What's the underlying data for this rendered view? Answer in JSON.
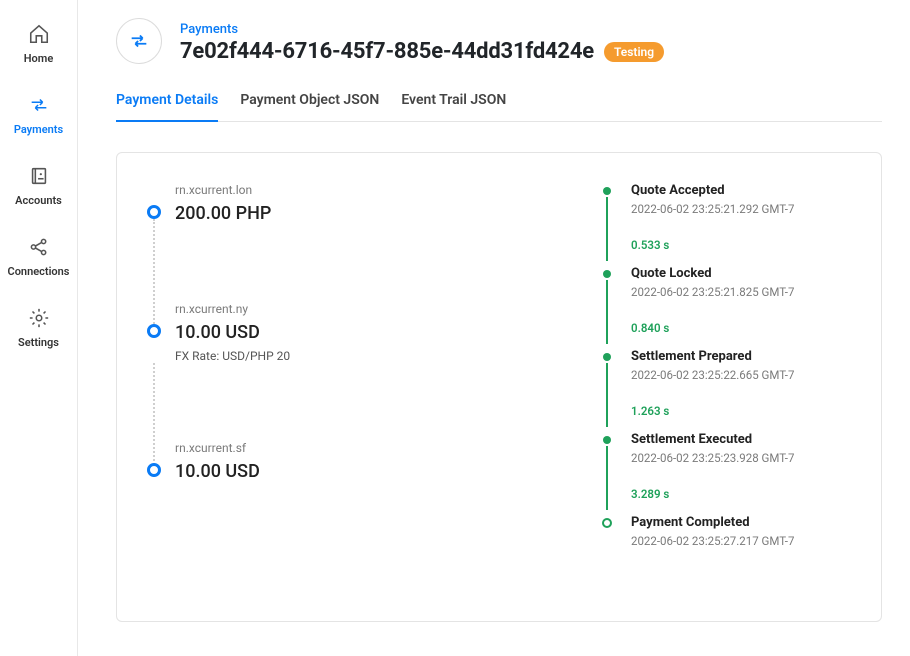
{
  "sidebar": {
    "items": [
      {
        "label": "Home"
      },
      {
        "label": "Payments"
      },
      {
        "label": "Accounts"
      },
      {
        "label": "Connections"
      },
      {
        "label": "Settings"
      }
    ]
  },
  "header": {
    "breadcrumb": "Payments",
    "title": "7e02f444-6716-45f7-885e-44dd31fd424e",
    "badge": "Testing"
  },
  "tabs": [
    {
      "label": "Payment Details"
    },
    {
      "label": "Payment Object JSON"
    },
    {
      "label": "Event Trail JSON"
    }
  ],
  "flow": [
    {
      "host": "rn.xcurrent.lon",
      "amount": "200.00 PHP",
      "sub": ""
    },
    {
      "host": "rn.xcurrent.ny",
      "amount": "10.00 USD",
      "sub": "FX Rate: USD/PHP 20"
    },
    {
      "host": "rn.xcurrent.sf",
      "amount": "10.00 USD",
      "sub": ""
    }
  ],
  "timeline": [
    {
      "title": "Quote Accepted",
      "time": "2022-06-02 23:25:21.292 GMT-7",
      "duration": "0.533 s"
    },
    {
      "title": "Quote Locked",
      "time": "2022-06-02 23:25:21.825 GMT-7",
      "duration": "0.840 s"
    },
    {
      "title": "Settlement Prepared",
      "time": "2022-06-02 23:25:22.665 GMT-7",
      "duration": "1.263 s"
    },
    {
      "title": "Settlement Executed",
      "time": "2022-06-02 23:25:23.928 GMT-7",
      "duration": "3.289 s"
    },
    {
      "title": "Payment Completed",
      "time": "2022-06-02 23:25:27.217 GMT-7",
      "duration": ""
    }
  ]
}
